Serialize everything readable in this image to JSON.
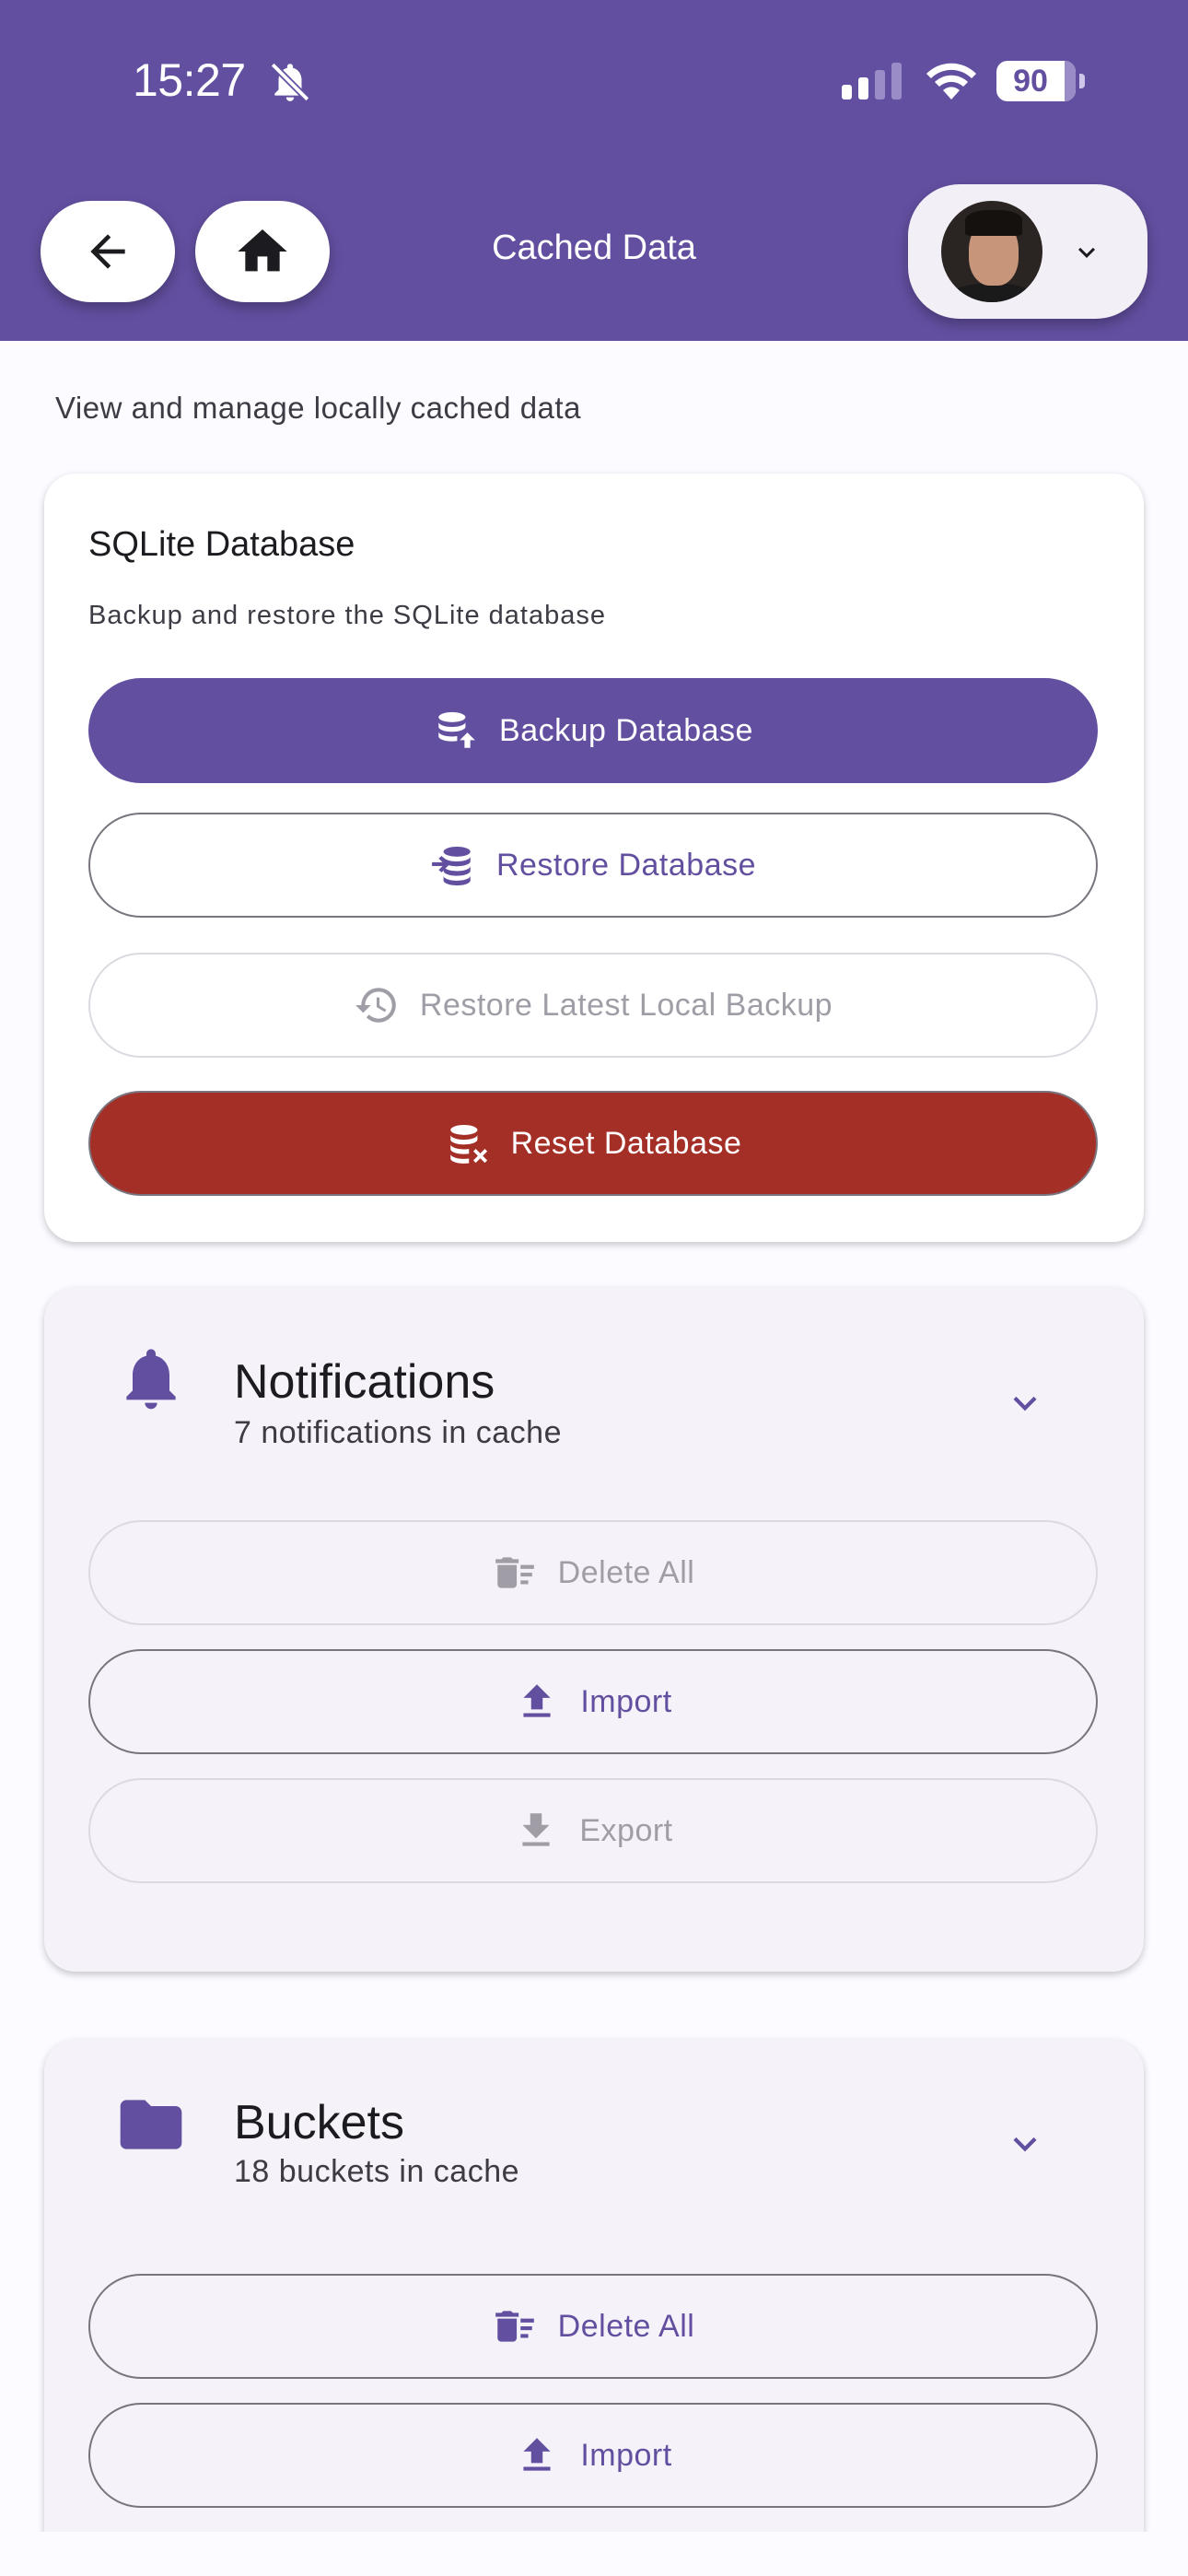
{
  "status_bar": {
    "time": "15:27",
    "battery": "90"
  },
  "header": {
    "title": "Cached Data"
  },
  "page": {
    "subtitle": "View and manage locally cached data"
  },
  "database": {
    "title": "SQLite Database",
    "description": "Backup and restore the SQLite database",
    "backup_label": "Backup Database",
    "restore_label": "Restore Database",
    "restore_latest_label": "Restore Latest Local Backup",
    "reset_label": "Reset Database"
  },
  "notifications": {
    "title": "Notifications",
    "count": "7 notifications in cache",
    "delete_label": "Delete All",
    "import_label": "Import",
    "export_label": "Export"
  },
  "buckets": {
    "title": "Buckets",
    "count": "18 buckets in cache",
    "delete_label": "Delete All",
    "import_label": "Import"
  },
  "colors": {
    "primary": "#634FA0",
    "danger": "#A42F27",
    "surface": "#F5F3F9"
  }
}
